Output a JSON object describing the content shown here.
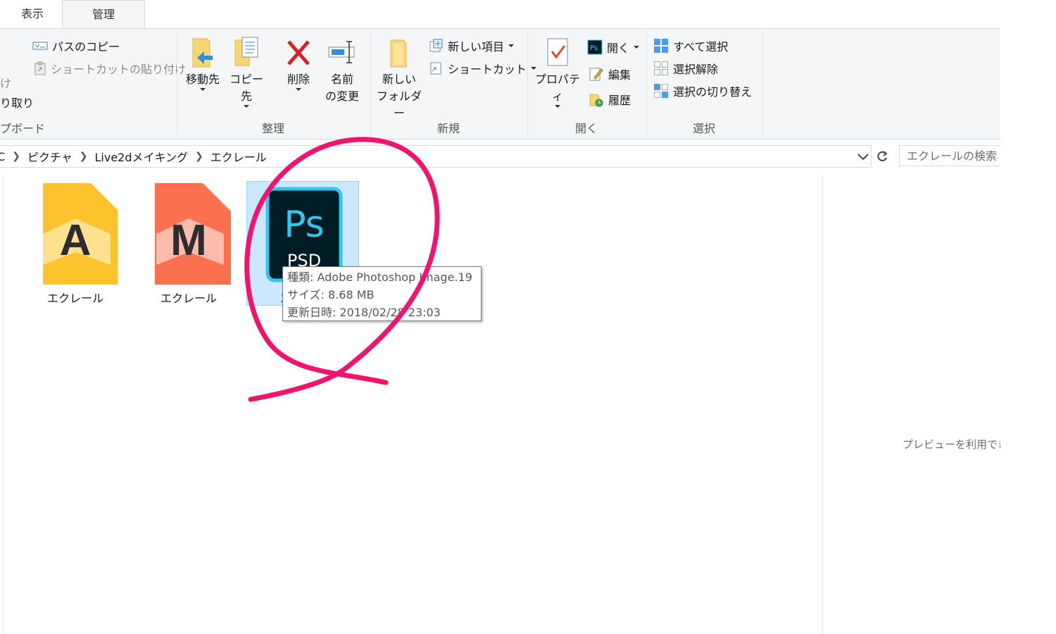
{
  "tabs": [
    {
      "label": "表示",
      "active": false
    },
    {
      "label": "管理",
      "active": true
    }
  ],
  "ribbon": {
    "clipboard": {
      "group_label": "プボード",
      "copy_path": "パスのコピー",
      "paste_shortcut": "ショートカットの貼り付け",
      "partial_top": "け",
      "cut": "り取り"
    },
    "organize": {
      "group_label": "整理",
      "move_to": "移動先",
      "copy_to": "コピー先",
      "delete": "削除",
      "rename_line1": "名前",
      "rename_line2": "の変更"
    },
    "new": {
      "group_label": "新規",
      "new_folder_line1": "新しい",
      "new_folder_line2": "フォルダー",
      "new_item": "新しい項目",
      "shortcut": "ショートカット"
    },
    "open": {
      "group_label": "開く",
      "properties": "プロパティ",
      "open": "開く",
      "edit": "編集",
      "history": "履歴"
    },
    "select": {
      "group_label": "選択",
      "select_all": "すべて選択",
      "select_none": "選択解除",
      "invert": "選択の切り替え"
    }
  },
  "address": {
    "crumbs": [
      "C",
      "ピクチャ",
      "Live2dメイキング",
      "エクレール"
    ],
    "search_placeholder": "エクレールの検索"
  },
  "files": [
    {
      "name": "エクレール",
      "icon": "illustrator-doc-icon",
      "letter": "A",
      "color": "#fcc32c"
    },
    {
      "name": "エクレール",
      "icon": "animate-doc-icon",
      "letter": "M",
      "color": "#fb7150"
    },
    {
      "name": "エ",
      "icon": "photoshop-psd-icon",
      "letter": "Ps",
      "sub": "PSD",
      "color": "#001d26",
      "accent": "#31c5f0",
      "selected": true
    }
  ],
  "tooltip": {
    "type": "種類: Adobe Photoshop Image.19",
    "size": "サイズ: 8.68 MB",
    "modified": "更新日時: 2018/02/28 23:03"
  },
  "preview": {
    "message": "プレビューを利用でき"
  },
  "colors": {
    "annotation": "#f0146e",
    "selection": "#cce8ff"
  }
}
